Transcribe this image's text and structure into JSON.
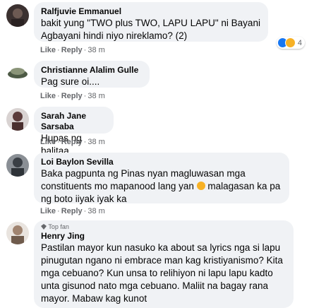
{
  "comments": [
    {
      "name": "Ralfjuvie Emmanuel",
      "text": "bakit yung \"TWO plus TWO, LAPU LAPU\" ni Bayani Agbayani hindi niyo nireklamo? (2)",
      "like": "Like",
      "reply": "Reply",
      "time": "38 m",
      "reaction_count": "4"
    },
    {
      "name": "Christianne Alalim Gulle",
      "text": "Pag sure oi....",
      "like": "Like",
      "reply": "Reply",
      "time": "38 m"
    },
    {
      "name": "Sarah Jane Sarsaba",
      "text": "Hupas ng balitaa",
      "like": "Like",
      "reply": "Reply",
      "time": "38 m"
    },
    {
      "name": "Loi Baylon Sevilla",
      "text_a": "Baka pagpunta ng Pinas nyan magluwasan mga constituents mo mapanood lang yan",
      "text_b": " malagasan ka pa ng boto iiyak iyak ka",
      "like": "Like",
      "reply": "Reply",
      "time": "38 m"
    },
    {
      "badge": "Top fan",
      "name": "Henry Jing",
      "text": "Pastilan mayor kun nasuko ka about sa lyrics nga si lapu pinugutan ngano ni embrace man kag kristiyanismo? Kita mga cebuano? Kun unsa to relihiyon ni lapu lapu kadto unta gisunod nato mga cebuano. Maliit na bagay rana mayor. Mabaw kag kunot"
    }
  ],
  "icons": {
    "like_reaction": "like-icon",
    "haha_reaction": "haha-icon",
    "badge": "diamond-icon",
    "emoji": "crying-laughing-emoji"
  },
  "colors": {
    "bubble": "#f0f2f5",
    "meta": "#65676b",
    "like_blue": "#1877f2",
    "haha_yellow": "#f7b125"
  }
}
